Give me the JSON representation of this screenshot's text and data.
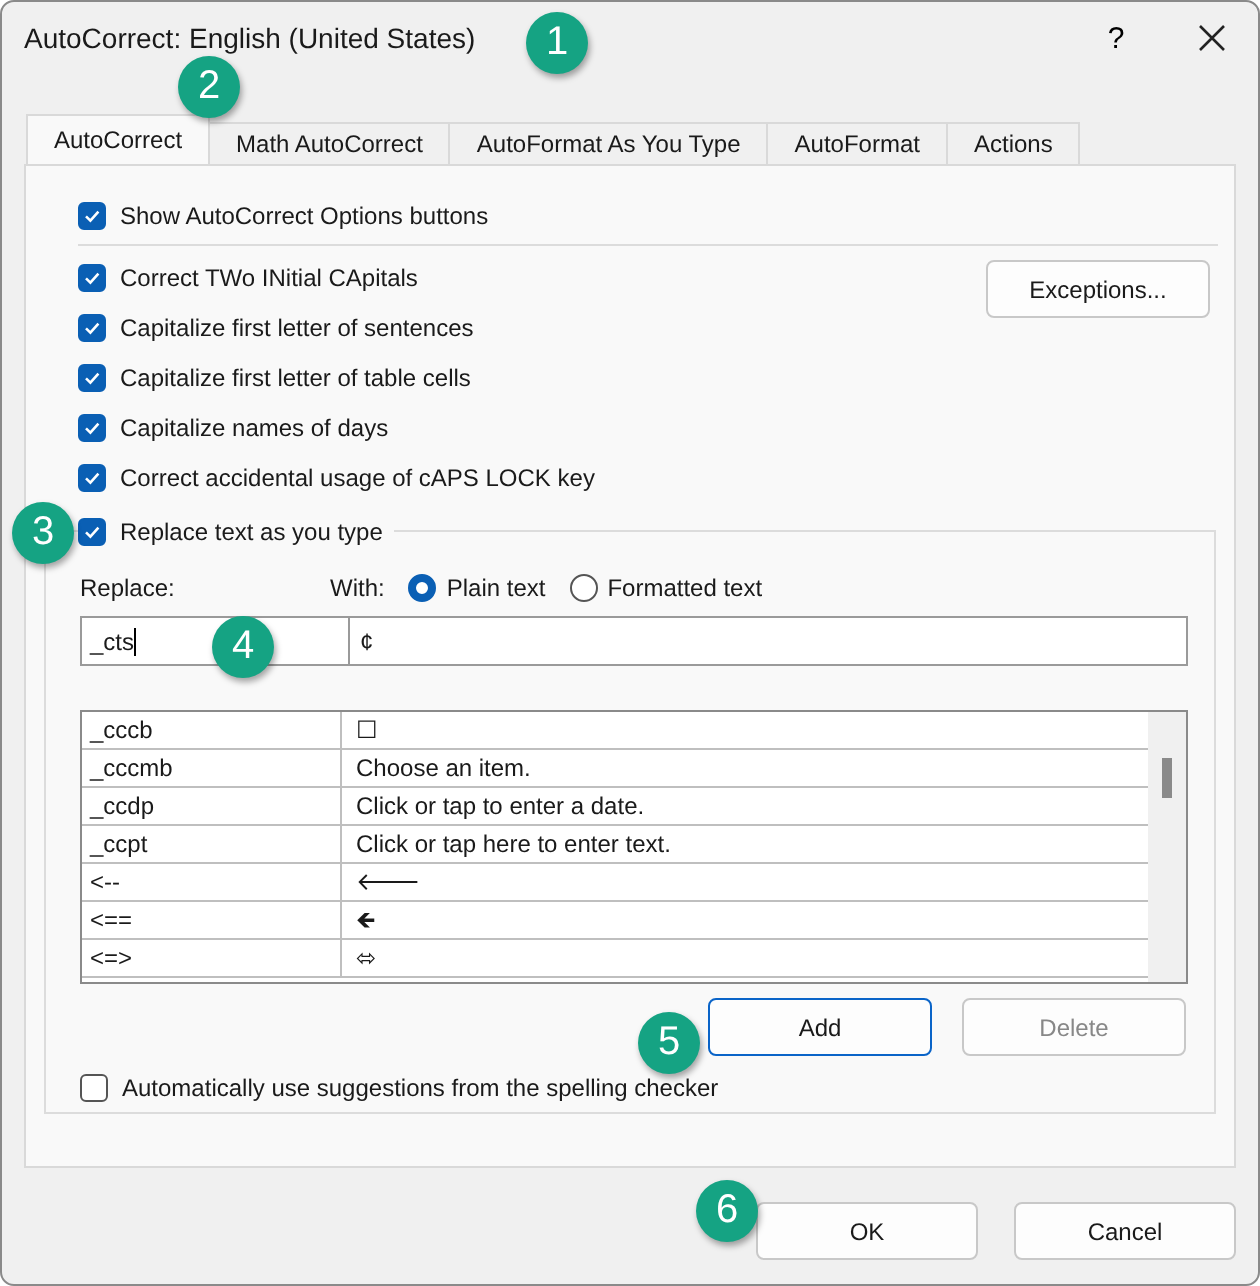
{
  "window": {
    "title": "AutoCorrect: English (United States)",
    "help": "?"
  },
  "tabs": [
    {
      "label": "AutoCorrect",
      "selected": true
    },
    {
      "label": "Math AutoCorrect",
      "selected": false
    },
    {
      "label": "AutoFormat As You Type",
      "selected": false
    },
    {
      "label": "AutoFormat",
      "selected": false
    },
    {
      "label": "Actions",
      "selected": false
    }
  ],
  "top_option": {
    "label": "Show AutoCorrect Options buttons",
    "checked": true
  },
  "options": [
    {
      "label": "Correct TWo INitial CApitals",
      "checked": true
    },
    {
      "label": "Capitalize first letter of sentences",
      "checked": true
    },
    {
      "label": "Capitalize first letter of table cells",
      "checked": true
    },
    {
      "label": "Capitalize names of days",
      "checked": true
    },
    {
      "label": "Correct accidental usage of cAPS LOCK key",
      "checked": true
    }
  ],
  "exceptions_button": "Exceptions...",
  "replace_group": {
    "label": "Replace text as you type",
    "checked": true,
    "replace_label": "Replace:",
    "with_label": "With:",
    "format_options": [
      {
        "label": "Plain text",
        "selected": true
      },
      {
        "label": "Formatted text",
        "selected": false
      }
    ],
    "replace_value": "_cts",
    "with_value": "¢",
    "rows": [
      {
        "replace": "_cccb",
        "with": "☐"
      },
      {
        "replace": "_cccmb",
        "with": "Choose an item."
      },
      {
        "replace": "_ccdp",
        "with": "Click or tap to enter a date."
      },
      {
        "replace": "_ccpt",
        "with": "Click or tap here to enter text."
      },
      {
        "replace": "<--",
        "with": "🡐"
      },
      {
        "replace": "<==",
        "with": "🡸"
      },
      {
        "replace": "<=>",
        "with": "⬄"
      }
    ],
    "add_button": {
      "label": "Add",
      "disabled": false
    },
    "delete_button": {
      "label": "Delete",
      "disabled": true
    },
    "spelling_option": {
      "label": "Automatically use suggestions from the spelling checker",
      "checked": false
    }
  },
  "buttons": [
    "OK",
    "Cancel"
  ],
  "callouts": [
    "1",
    "2",
    "3",
    "4",
    "5",
    "6"
  ]
}
